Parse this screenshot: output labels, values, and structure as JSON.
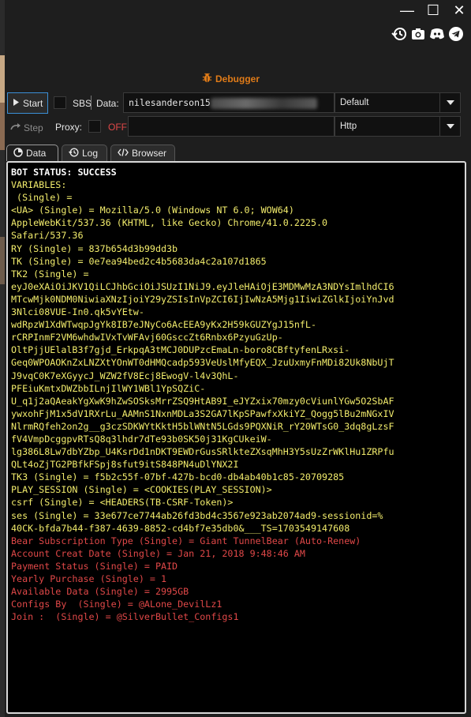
{
  "window": {
    "minimize_glyph": "—",
    "maximize_glyph": "☐",
    "close_glyph": "✕"
  },
  "toolbar_icons": [
    "history-icon",
    "camera-icon",
    "discord-icon",
    "telegram-icon"
  ],
  "debugger": {
    "title": "Debugger",
    "accent": "#e07b18"
  },
  "controls": {
    "start_label": "Start",
    "step_label": "Step",
    "sbs_label": "SBS",
    "data_label": "Data:",
    "data_value": "nilesanderson15",
    "data_select": "Default",
    "proxy_label": "Proxy:",
    "proxy_status": "OFF",
    "proxy_select": "Http"
  },
  "tabs": [
    {
      "label": "Data",
      "icon": "data-icon",
      "active": true
    },
    {
      "label": "Log",
      "icon": "history-icon",
      "active": false
    },
    {
      "label": "Browser",
      "icon": "code-icon",
      "active": false
    }
  ],
  "output": {
    "lines": [
      {
        "text": "BOT STATUS: SUCCESS",
        "color": "white"
      },
      {
        "text": "VARIABLES:",
        "color": "yellow"
      },
      {
        "text": " (Single) =",
        "color": "yellow"
      },
      {
        "text": "<UA> (Single) = Mozilla/5.0 (Windows NT 6.0; WOW64)",
        "color": "yellow"
      },
      {
        "text": "AppleWebKit/537.36 (KHTML, like Gecko) Chrome/41.0.2225.0",
        "color": "yellow"
      },
      {
        "text": "Safari/537.36",
        "color": "yellow"
      },
      {
        "text": "RY (Single) = 837b654d3b99dd3b",
        "color": "yellow"
      },
      {
        "text": "TK (Single) = 0e7ea94bed2c4b5683da4c2a107d1865",
        "color": "yellow"
      },
      {
        "text": "TK2 (Single) =",
        "color": "yellow"
      },
      {
        "text": "eyJ0eXAiOiJKV1QiLCJhbGciOiJSUzI1NiJ9.eyJleHAiOjE3MDMwMzA3NDYsImlhdCI6",
        "color": "yellow"
      },
      {
        "text": "MTcwMjk0NDM0NiwiaXNzIjoiY29yZSIsInVpZCI6IjIwNzA5Mjg1IiwiZGlkIjoiYnJvd",
        "color": "yellow"
      },
      {
        "text": "3Nlci08VUE-In0.qk5vYEtw-",
        "color": "yellow"
      },
      {
        "text": "wdRpzW1XdWTwqpJgYk8IB7eJNyCo6AcEEA9yKx2H59kGUZYgJ15nfL-",
        "color": "yellow"
      },
      {
        "text": "rCRPInmF2VM6whdwIVxTvWFAvj60GsccZt6Rnbx6PzyuGzUp-",
        "color": "yellow"
      },
      {
        "text": "OltPjjUElalB3f7gjd_ErkpqA3tMCJ0DUPzcEmaLn-boro8CBftyfenLRxsi-",
        "color": "yellow"
      },
      {
        "text": "Geq0WPOAOKnZxLNZXtYOnWT0dHMQcadp593VeUslMfyEQX_JzuUxmyFnMDi82Uk8NbUjT",
        "color": "yellow"
      },
      {
        "text": "J9vqC0K7eXGyycJ_WZW2fV8Ecj8EwogV-l4v3QhL-",
        "color": "yellow"
      },
      {
        "text": "PFEiuKmtxDWZbbILnjIlWY1WBl1YpSQZiC-",
        "color": "yellow"
      },
      {
        "text": "U_q1j2aQAeakYgXwK9hZwSOSksMrrZSQ9HtAB9I_eJYZxix70mzy0cViunlYGw5O2SbAF",
        "color": "yellow"
      },
      {
        "text": "ywxohFjM1x5dV1RXrLu_AAMnS1NxnMDLa3S2GA7lKpSPawfxXkiYZ_Qogg5lBu2mNGxIV",
        "color": "yellow"
      },
      {
        "text": "NlrmRQfeh2on2g__g3czSDKWYtKktH5blWNtN5LGds9PQXNiR_rY20WTsG0_3dq8gLzsF",
        "color": "yellow"
      },
      {
        "text": "fV4VmpDcggpvRTsQ8q3lhdr7dTe93b0SK50j31KgCUkeiW-",
        "color": "yellow"
      },
      {
        "text": "lg386L8Lw7dbYZbp_U4KsrDd1nDKT9EWDrGusSRlkteZXsqMhH3Y5sUzZrWKlHu1ZRPfu",
        "color": "yellow"
      },
      {
        "text": "QLt4oZjTG2PBfkFSpj8sfut9itS848PN4uDlYNX2I",
        "color": "yellow"
      },
      {
        "text": "TK3 (Single) = f5b2c55f-07bf-427b-bcd0-db4ab40b1c85-20709285",
        "color": "yellow"
      },
      {
        "text": "PLAY_SESSION (Single) = <COOKIES(PLAY_SESSION)>",
        "color": "yellow"
      },
      {
        "text": "csrf (Single) = <HEADERS(TB-CSRF-Token)>",
        "color": "yellow"
      },
      {
        "text": "ses (Single) = 33e677ce7744ab26fd3bd4c3567e923ab2074ad9-sessionid=%",
        "color": "yellow"
      },
      {
        "text": "40CK-bfda7b44-f387-4639-8852-cd4bf7e35db0&___TS=1703549147608",
        "color": "yellow"
      },
      {
        "text": "Bear Subscription Type (Single) = Giant TunnelBear (Auto-Renew)",
        "color": "red"
      },
      {
        "text": "Account Creat Date (Single) = Jan 21, 2018 9:48:46 AM",
        "color": "red"
      },
      {
        "text": "Payment Status (Single) = PAID",
        "color": "red"
      },
      {
        "text": "Yearly Purchase (Single) = 1",
        "color": "red"
      },
      {
        "text": "Available Data (Single) = 2995GB",
        "color": "red"
      },
      {
        "text": "Configs By  (Single) = @ALone_DevilLz1",
        "color": "red"
      },
      {
        "text": "Join :  (Single) = @SilverBullet_Configs1",
        "color": "red"
      }
    ]
  }
}
